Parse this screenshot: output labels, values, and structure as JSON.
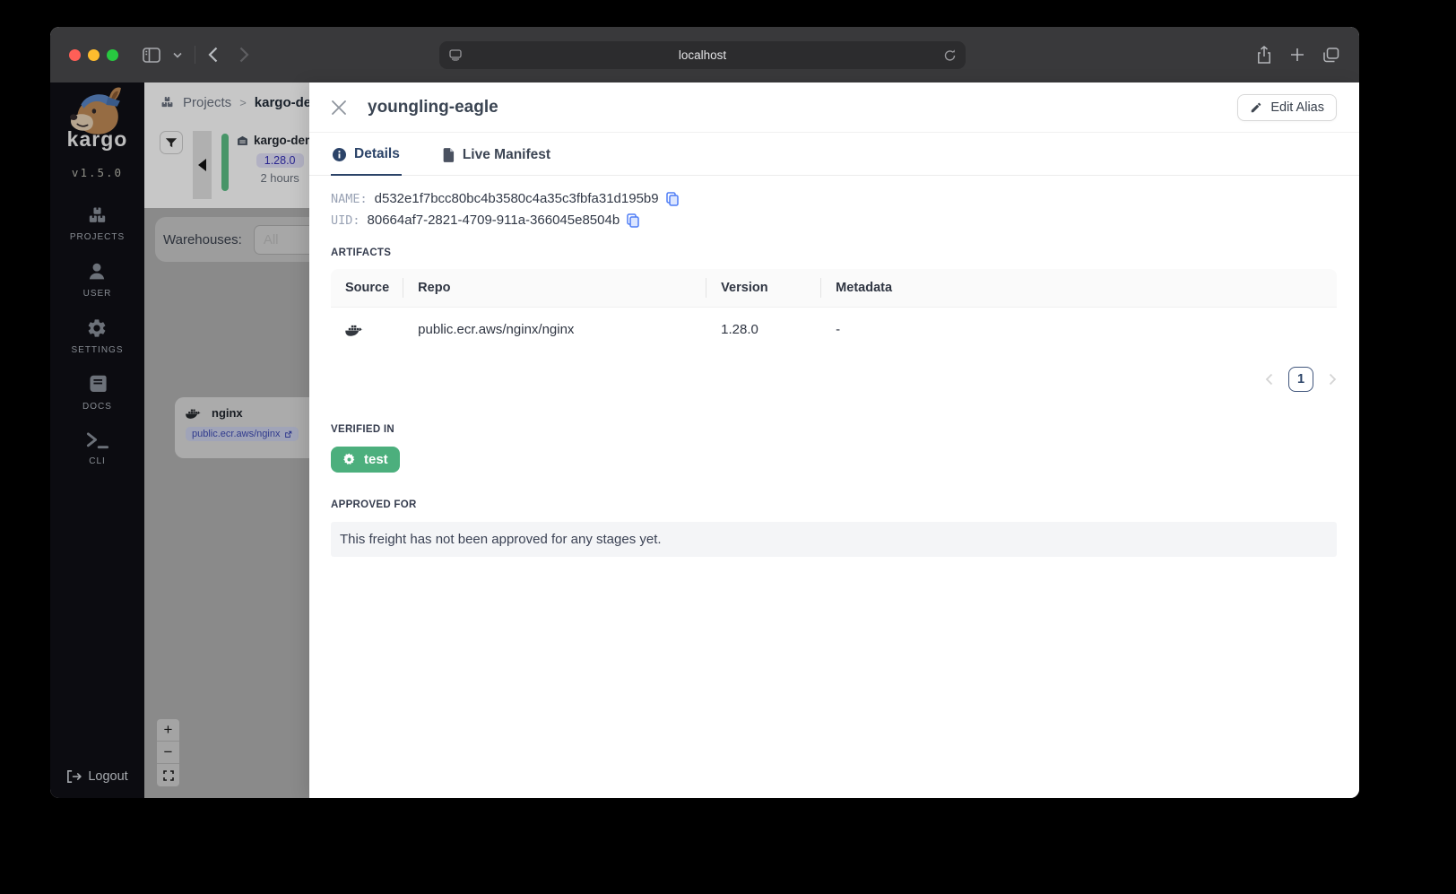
{
  "browser": {
    "url_text": "localhost"
  },
  "sidebar": {
    "wordmark": "kargo",
    "version": "v1.5.0",
    "items": [
      {
        "label": "PROJECTS"
      },
      {
        "label": "USER"
      },
      {
        "label": "SETTINGS"
      },
      {
        "label": "DOCS"
      },
      {
        "label": "CLI"
      }
    ],
    "logout_label": "Logout"
  },
  "page": {
    "breadcrumb_root": "Projects",
    "breadcrumb_separator": ">",
    "breadcrumb_current": "kargo-demo",
    "freight_card": {
      "title": "kargo-demo",
      "version": "1.28.0",
      "age": "2 hours"
    },
    "warehouses_label": "Warehouses:",
    "warehouses_value": "All",
    "node": {
      "title": "nginx",
      "badge": "public.ecr.aws/nginx"
    },
    "zoom_in": "+",
    "zoom_out": "−"
  },
  "drawer": {
    "title": "youngling-eagle",
    "edit_alias_label": "Edit Alias",
    "tabs": [
      {
        "label": "Details"
      },
      {
        "label": "Live Manifest"
      }
    ],
    "name_label": "NAME:",
    "name_value": "d532e1f7bcc80bc4b3580c4a35c3fbfa31d195b9",
    "uid_label": "UID:",
    "uid_value": "80664af7-2821-4709-911a-366045e8504b",
    "artifacts_heading": "ARTIFACTS",
    "table": {
      "columns": [
        "Source",
        "Repo",
        "Version",
        "Metadata"
      ],
      "row": {
        "repo": "public.ecr.aws/nginx/nginx",
        "version": "1.28.0",
        "metadata": "-"
      }
    },
    "pagination": {
      "page": "1"
    },
    "verified_heading": "VERIFIED IN",
    "verified_stage": "test",
    "approved_heading": "APPROVED FOR",
    "approved_empty": "This freight has not been approved for any stages yet."
  },
  "colors": {
    "accent_navy": "#2b4368",
    "stage_green": "#4caf7d",
    "copy_blue": "#4e7df5",
    "freight_badge_bg": "#e4e3fa",
    "freight_badge_text": "#3530b8"
  }
}
